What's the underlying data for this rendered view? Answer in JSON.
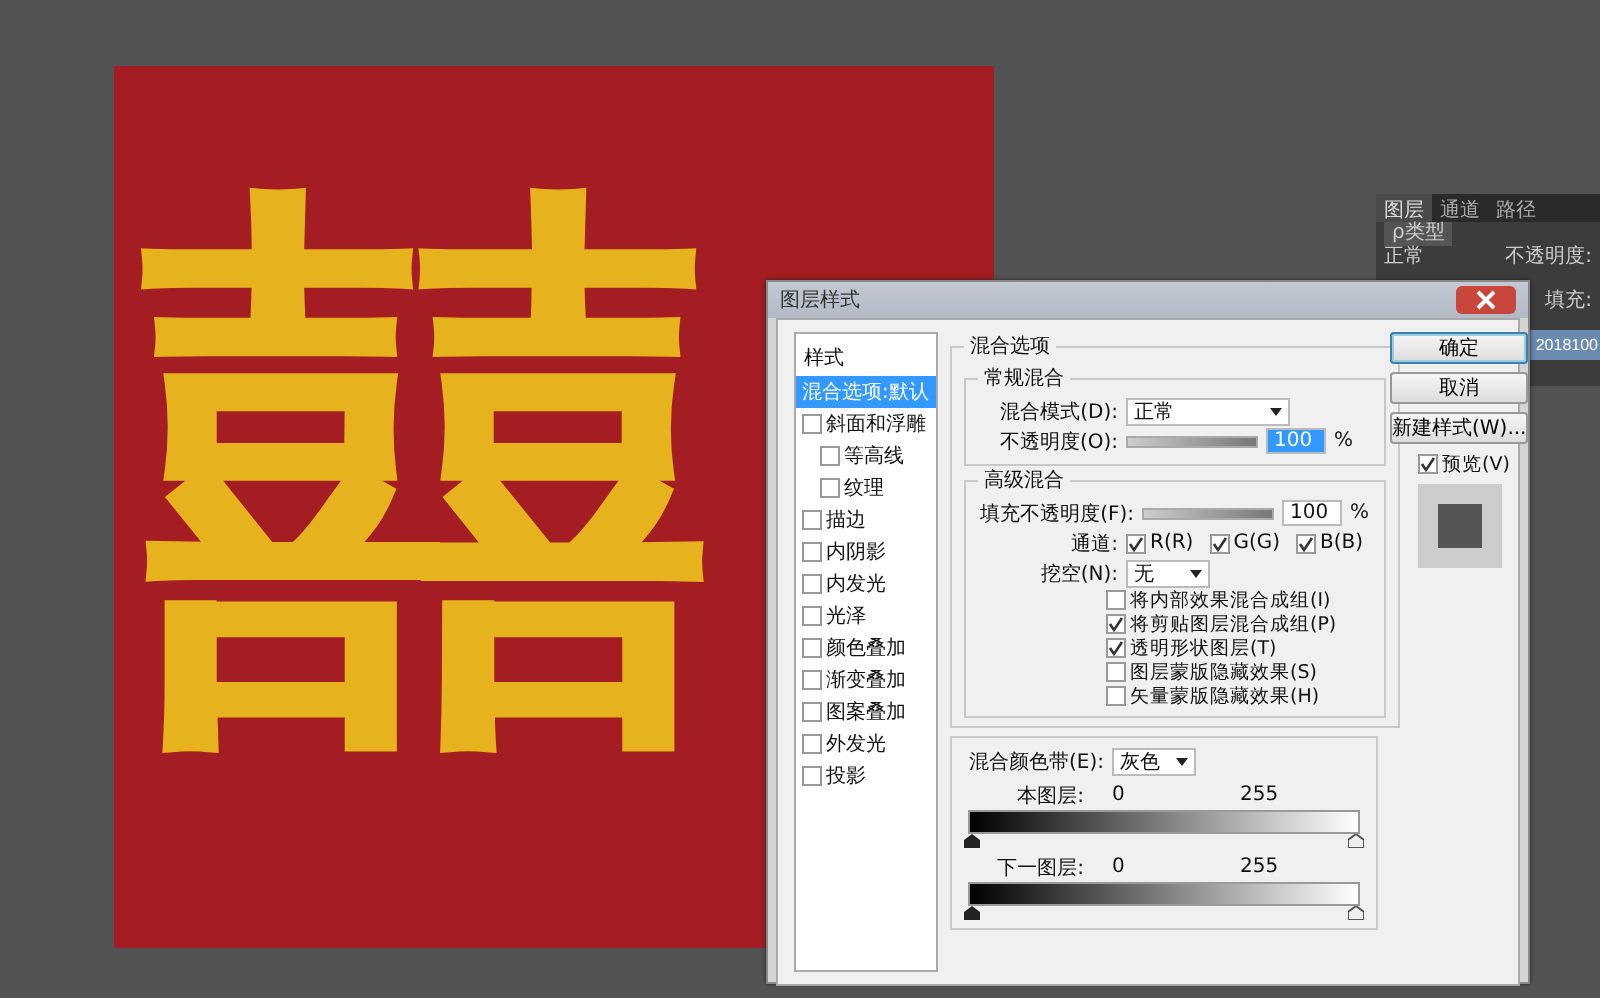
{
  "canvas": {
    "artwork": "囍"
  },
  "layers_panel": {
    "tabs": [
      {
        "label": "图层",
        "selected": true
      },
      {
        "label": "通道",
        "selected": false
      },
      {
        "label": "路径",
        "selected": false
      }
    ],
    "filter": "ρ类型",
    "blend_mode": "正常",
    "opacity_label": "不透明度:",
    "fill_label": "填充:",
    "layer_name": "2018100"
  },
  "dialog": {
    "title": "图层样式",
    "styles_header": "样式",
    "styles": [
      {
        "label": "混合选项:默认",
        "kind": "plain",
        "selected": true
      },
      {
        "label": "斜面和浮雕",
        "kind": "check",
        "checked": false,
        "selected": false,
        "children": [
          {
            "label": "等高线",
            "kind": "check",
            "checked": false,
            "selected": false
          },
          {
            "label": "纹理",
            "kind": "check",
            "checked": false,
            "selected": false
          }
        ]
      },
      {
        "label": "描边",
        "kind": "check",
        "checked": false,
        "selected": false
      },
      {
        "label": "内阴影",
        "kind": "check",
        "checked": false,
        "selected": false
      },
      {
        "label": "内发光",
        "kind": "check",
        "checked": false,
        "selected": false
      },
      {
        "label": "光泽",
        "kind": "check",
        "checked": false,
        "selected": false
      },
      {
        "label": "颜色叠加",
        "kind": "check",
        "checked": false,
        "selected": false
      },
      {
        "label": "渐变叠加",
        "kind": "check",
        "checked": false,
        "selected": false
      },
      {
        "label": "图案叠加",
        "kind": "check",
        "checked": false,
        "selected": false
      },
      {
        "label": "外发光",
        "kind": "check",
        "checked": false,
        "selected": false
      },
      {
        "label": "投影",
        "kind": "check",
        "checked": false,
        "selected": false
      }
    ],
    "blending": {
      "title": "混合选项",
      "general": {
        "title": "常规混合",
        "mode_label": "混合模式(D):",
        "mode": "正常",
        "opacity_label": "不透明度(O):",
        "opacity_slider": {
          "level": 1
        },
        "opacity": "100",
        "unit": "%"
      },
      "advanced": {
        "title": "高级混合",
        "fill_label": "填充不透明度(F):",
        "fill_slider": {
          "level": 1
        },
        "fill": "100",
        "unit": "%",
        "channels_label": "通道:",
        "channels": [
          {
            "label": "R(R)",
            "checked": true
          },
          {
            "label": "G(G)",
            "checked": true
          },
          {
            "label": "B(B)",
            "checked": true
          }
        ],
        "knockout_label": "挖空(N):",
        "knockout": "无",
        "options": [
          {
            "label": "将内部效果混合成组(I)",
            "checked": false
          },
          {
            "label": "将剪贴图层混合成组(P)",
            "checked": true
          },
          {
            "label": "透明形状图层(T)",
            "checked": true
          },
          {
            "label": "图层蒙版隐藏效果(S)",
            "checked": false
          },
          {
            "label": "矢量蒙版隐藏效果(H)",
            "checked": false
          }
        ]
      },
      "blend_if": {
        "label": "混合颜色带(E):",
        "value": "灰色",
        "ramps": [
          {
            "label": "本图层:",
            "low": "0",
            "high": "255"
          },
          {
            "label": "下一图层:",
            "low": "0",
            "high": "255"
          }
        ]
      }
    },
    "buttons": [
      {
        "label": "确定",
        "default": true
      },
      {
        "label": "取消",
        "default": false
      },
      {
        "label": "新建样式(W)...",
        "default": false
      }
    ],
    "preview": {
      "label": "预览(V)",
      "checked": true
    }
  }
}
